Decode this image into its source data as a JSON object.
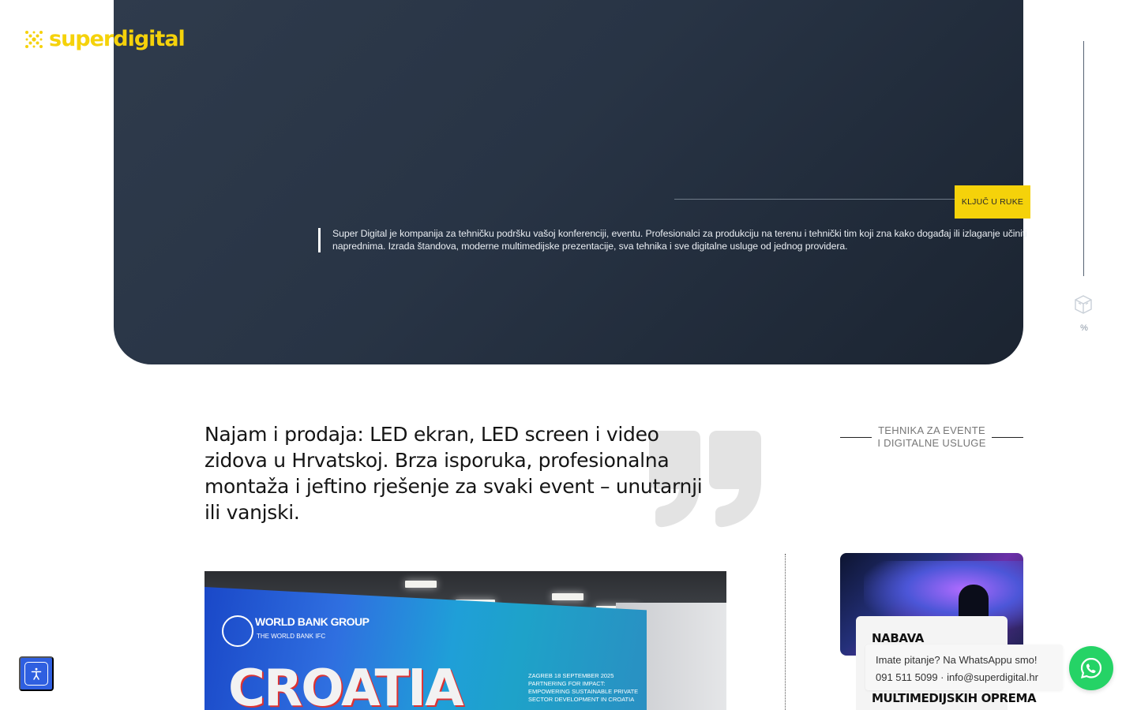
{
  "brand": {
    "name": "superdigital",
    "accent": "#f5d20a"
  },
  "hero": {
    "cta_label": "KLJUČ U RUKE",
    "description": "Super Digital je kompanija za tehničku podršku vašoj konferenciji, eventu. Profesionalci za produkciju na terenu i tehnički tim koji zna kako događaj ili izlaganje učiniti naprednima. Izrada štandova, moderne multimedijske prezentacije, sva tehnika i sve digitalne usluge od jednog providera.",
    "scroll_percent_label": "%",
    "background": "#283445"
  },
  "main": {
    "headline": "Najam i prodaja: LED ekran, LED screen i video zidova u Hrvatskoj. Brza isporuka, profesionalna montaža i jeftino rješenje za svaki event – unutarnji ili vanjski.",
    "image": {
      "brand_line_1": "WORLD BANK GROUP",
      "brand_line_2": "THE WORLD BANK   IFC",
      "big_word": "CROATIA",
      "event_text": "ZAGREB 18 SEPTEMBER 2025 PARTNERING FOR IMPACT: EMPOWERING SUSTAINABLE PRIVATE SECTOR DEVELOPMENT IN CROATIA"
    }
  },
  "sidebar": {
    "title_line_1": "TEHNIKA ZA EVENTE",
    "title_line_2": "I DIGITALNE USLUGE",
    "cards": [
      {
        "label": "NABAVA"
      },
      {
        "label": "MULTIMEDIJSKIH OPREMA"
      }
    ]
  },
  "whatsapp": {
    "line_1_a": "Imate pitanje?",
    "line_1_b": " Na WhatsAppu smo!",
    "line_2": "091 511 5099 · info@superdigital.hr",
    "color": "#25d366"
  },
  "accessibility": {
    "color": "#2f5fe0"
  },
  "icons": [
    "logo-mark-icon",
    "cube-book-icon",
    "quote-icon",
    "whatsapp-icon",
    "accessibility-icon"
  ]
}
